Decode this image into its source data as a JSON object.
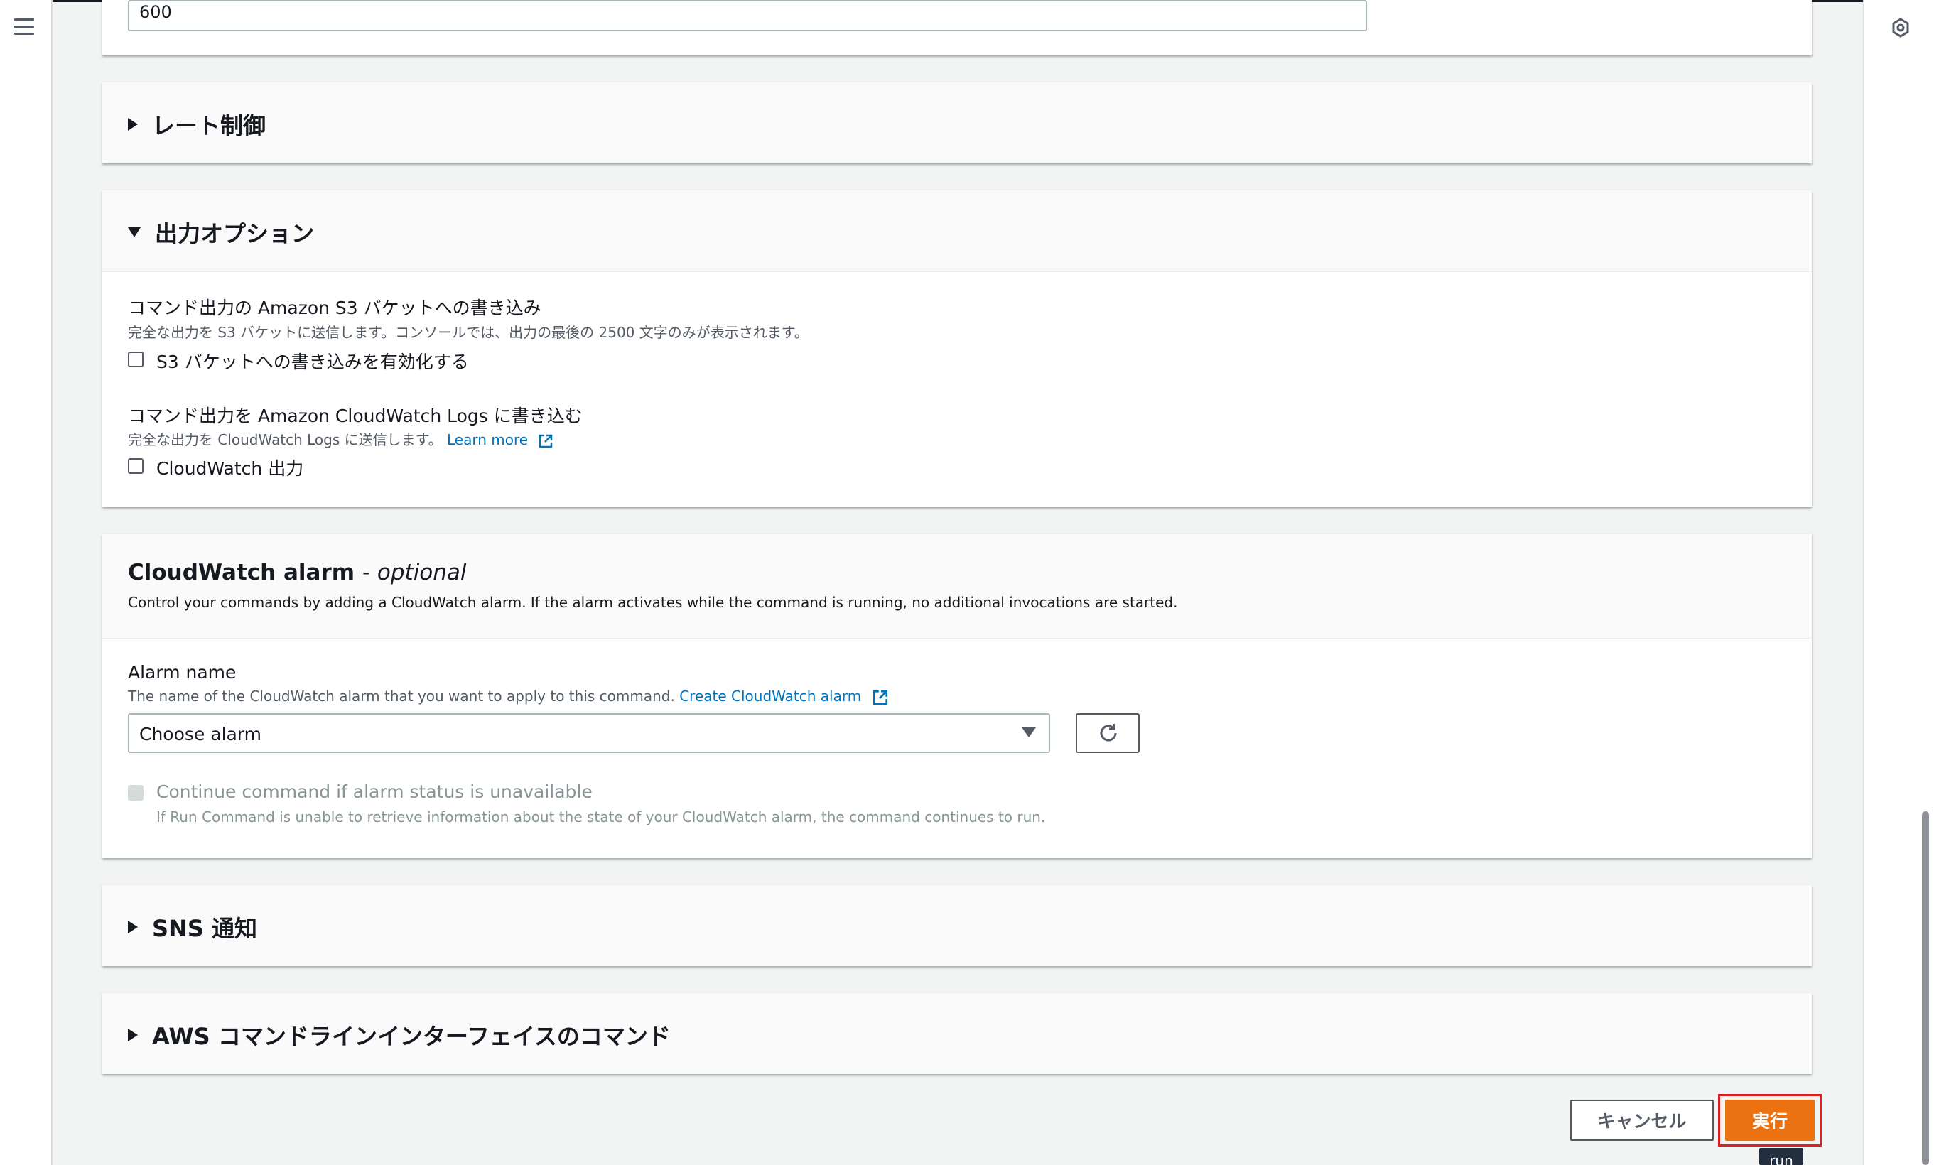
{
  "top_field": {
    "value": "600"
  },
  "rate_control": {
    "title": "レート制御"
  },
  "output_options": {
    "title": "出力オプション",
    "s3": {
      "label": "コマンド出力の Amazon S3 バケットへの書き込み",
      "description": "完全な出力を S3 バケットに送信します。コンソールでは、出力の最後の 2500 文字のみが表示されます。",
      "checkbox_label": "S3 バケットへの書き込みを有効化する"
    },
    "cloudwatch": {
      "label": "コマンド出力を Amazon CloudWatch Logs に書き込む",
      "description": "完全な出力を CloudWatch Logs に送信します。",
      "learn_more": "Learn more",
      "checkbox_label": "CloudWatch 出力"
    }
  },
  "alarm": {
    "title": "CloudWatch alarm",
    "title_suffix": "- optional",
    "description": "Control your commands by adding a CloudWatch alarm. If the alarm activates while the command is running, no additional invocations are started.",
    "name_label": "Alarm name",
    "name_description": "The name of the CloudWatch alarm that you want to apply to this command.",
    "create_link": "Create CloudWatch alarm",
    "select_value": "Choose alarm",
    "continue_label": "Continue command if alarm status is unavailable",
    "continue_description": "If Run Command is unable to retrieve information about the state of your CloudWatch alarm, the command continues to run."
  },
  "sns": {
    "title": "SNS 通知"
  },
  "cli": {
    "title": "AWS コマンドラインインターフェイスのコマンド"
  },
  "footer": {
    "cancel_label": "キャンセル",
    "run_label": "実行",
    "tooltip": "run"
  },
  "colors": {
    "accent": "#ec7211",
    "link": "#0073bb",
    "highlight": "#e02020"
  },
  "icons": [
    "menu-icon",
    "settings-icon",
    "caret-right-icon",
    "caret-down-icon",
    "external-link-icon",
    "dropdown-arrow-icon",
    "refresh-icon"
  ]
}
